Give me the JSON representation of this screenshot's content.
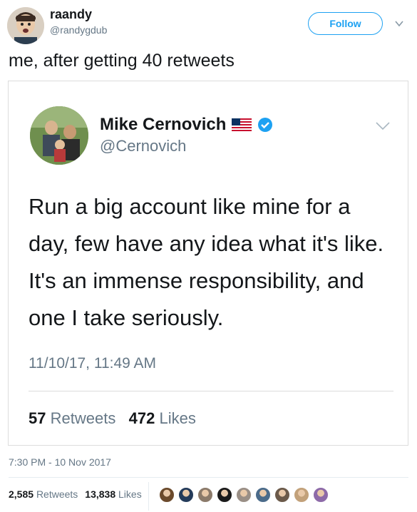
{
  "user": {
    "name": "raandy",
    "handle": "@randygdub"
  },
  "follow_label": "Follow",
  "tweet_text": "me, after getting 40 retweets",
  "embedded": {
    "name": "Mike Cernovich",
    "handle": "@Cernovich",
    "text": "Run a big account like mine for a day, few have any idea what it's like. It's an immense responsibility, and one I take seriously.",
    "time": "11/10/17, 11:49 AM",
    "retweets_count": "57",
    "retweets_label": "Retweets",
    "likes_count": "472",
    "likes_label": "Likes"
  },
  "timestamp": "7:30 PM - 10 Nov 2017",
  "stats": {
    "retweets_count": "2,585",
    "retweets_label": "Retweets",
    "likes_count": "13,838",
    "likes_label": "Likes"
  },
  "colors": {
    "accent": "#1da1f2",
    "muted": "#657786",
    "text": "#14171a"
  },
  "likers": [
    "#6b4a2c",
    "#243b5a",
    "#8b7a6a",
    "#1a1a1a",
    "#9a8f86",
    "#4b6b8a",
    "#6b5a4a",
    "#c2a17a",
    "#8d6aa8"
  ]
}
